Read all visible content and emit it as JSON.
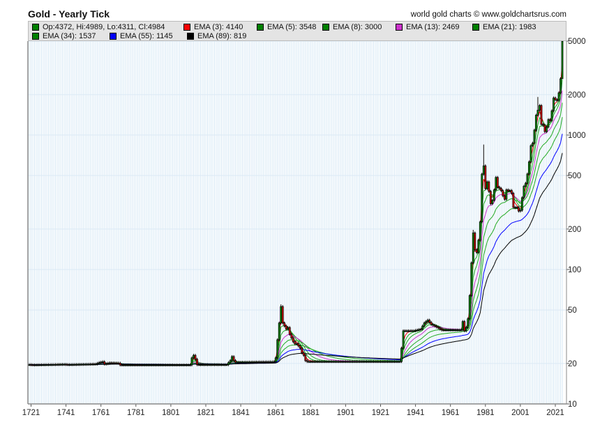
{
  "chart_data": {
    "type": "candlestick",
    "title": "Gold - Yearly Tick",
    "credit": "world gold charts © www.goldchartsrus.com",
    "y_scale": "log",
    "ylim": [
      10,
      5000
    ],
    "xlim": [
      1720,
      2025
    ],
    "y_ticks": [
      "5000",
      "2000",
      "1000",
      "500",
      "200",
      "100",
      "50",
      "20",
      "10"
    ],
    "x_ticks": [
      "1721",
      "1741",
      "1761",
      "1781",
      "1801",
      "1821",
      "1841",
      "1861",
      "1881",
      "1901",
      "1921",
      "1941",
      "1961",
      "1981",
      "2001",
      "2021"
    ],
    "legend": [
      {
        "label": "Op:4372, Hi:4989, Lo:4311, Cl:4984",
        "color": "#008000"
      },
      {
        "label": "EMA (3): 4140",
        "color": "#ff0000"
      },
      {
        "label": "EMA (5): 3548",
        "color": "#008000"
      },
      {
        "label": "EMA (8): 3000",
        "color": "#008000"
      },
      {
        "label": "EMA (13): 2469",
        "color": "#cc33cc"
      },
      {
        "label": "EMA (21): 1983",
        "color": "#008000"
      },
      {
        "label": "EMA (34): 1537",
        "color": "#008000"
      },
      {
        "label": "EMA (55): 1145",
        "color": "#0000ff"
      },
      {
        "label": "EMA (89): 819",
        "color": "#000000"
      }
    ],
    "ema_periods": [
      3,
      5,
      8,
      13,
      21,
      34,
      55,
      89
    ],
    "ema_colors": [
      "#ff0000",
      "#22aa22",
      "#22aa22",
      "#cc33cc",
      "#22aa22",
      "#22aa22",
      "#0000ff",
      "#000000"
    ],
    "close_keypoints": [
      [
        1720,
        19.6
      ],
      [
        1722,
        19.5
      ],
      [
        1740,
        19.7
      ],
      [
        1742,
        19.6
      ],
      [
        1758,
        19.8
      ],
      [
        1760,
        20.3
      ],
      [
        1762,
        20.6
      ],
      [
        1763,
        19.8
      ],
      [
        1766,
        20.2
      ],
      [
        1771,
        20.1
      ],
      [
        1772,
        19.5
      ],
      [
        1812,
        19.5
      ],
      [
        1813,
        22
      ],
      [
        1814,
        23
      ],
      [
        1815,
        21.5
      ],
      [
        1816,
        19.6
      ],
      [
        1833,
        19.6
      ],
      [
        1835,
        21
      ],
      [
        1836,
        22.5
      ],
      [
        1837,
        21
      ],
      [
        1838,
        20.4
      ],
      [
        1860,
        20.6
      ],
      [
        1861,
        22
      ],
      [
        1862,
        30
      ],
      [
        1863,
        40
      ],
      [
        1864,
        53
      ],
      [
        1865,
        40
      ],
      [
        1866,
        38
      ],
      [
        1867,
        36
      ],
      [
        1868,
        37
      ],
      [
        1869,
        33
      ],
      [
        1870,
        31
      ],
      [
        1871,
        29
      ],
      [
        1872,
        28
      ],
      [
        1873,
        28
      ],
      [
        1874,
        27
      ],
      [
        1875,
        26
      ],
      [
        1876,
        24
      ],
      [
        1877,
        23
      ],
      [
        1878,
        21
      ],
      [
        1879,
        20.67
      ],
      [
        1932,
        20.67
      ],
      [
        1933,
        26
      ],
      [
        1934,
        35
      ],
      [
        1940,
        35
      ],
      [
        1944,
        36
      ],
      [
        1946,
        40
      ],
      [
        1948,
        42
      ],
      [
        1950,
        39
      ],
      [
        1952,
        38
      ],
      [
        1956,
        35.5
      ],
      [
        1967,
        35.5
      ],
      [
        1968,
        41
      ],
      [
        1969,
        35
      ],
      [
        1970,
        37
      ],
      [
        1971,
        43
      ],
      [
        1972,
        64
      ],
      [
        1973,
        112
      ],
      [
        1974,
        187
      ],
      [
        1975,
        140
      ],
      [
        1976,
        134
      ],
      [
        1977,
        165
      ],
      [
        1978,
        226
      ],
      [
        1979,
        512
      ],
      [
        1980,
        590
      ],
      [
        1981,
        400
      ],
      [
        1982,
        448
      ],
      [
        1983,
        381
      ],
      [
        1984,
        309
      ],
      [
        1985,
        327
      ],
      [
        1986,
        391
      ],
      [
        1987,
        484
      ],
      [
        1988,
        410
      ],
      [
        1989,
        401
      ],
      [
        1990,
        386
      ],
      [
        1991,
        353
      ],
      [
        1992,
        333
      ],
      [
        1993,
        391
      ],
      [
        1994,
        383
      ],
      [
        1995,
        387
      ],
      [
        1996,
        369
      ],
      [
        1997,
        290
      ],
      [
        1998,
        288
      ],
      [
        1999,
        290
      ],
      [
        2000,
        272
      ],
      [
        2001,
        276
      ],
      [
        2002,
        342
      ],
      [
        2003,
        416
      ],
      [
        2004,
        438
      ],
      [
        2005,
        513
      ],
      [
        2006,
        632
      ],
      [
        2007,
        834
      ],
      [
        2008,
        870
      ],
      [
        2009,
        1088
      ],
      [
        2010,
        1405
      ],
      [
        2011,
        1531
      ],
      [
        2012,
        1658
      ],
      [
        2013,
        1201
      ],
      [
        2014,
        1184
      ],
      [
        2015,
        1060
      ],
      [
        2016,
        1146
      ],
      [
        2017,
        1303
      ],
      [
        2018,
        1279
      ],
      [
        2019,
        1515
      ],
      [
        2020,
        1888
      ],
      [
        2021,
        1829
      ],
      [
        2022,
        1812
      ],
      [
        2023,
        2063
      ],
      [
        2024,
        2625
      ],
      [
        2025,
        4984
      ]
    ],
    "high_overrides": [
      [
        1980,
        850
      ],
      [
        1864,
        55
      ],
      [
        2025,
        4989
      ],
      [
        1974,
        197
      ],
      [
        2011,
        1920
      ]
    ],
    "low_overrides": [
      [
        2025,
        4311
      ]
    ]
  }
}
